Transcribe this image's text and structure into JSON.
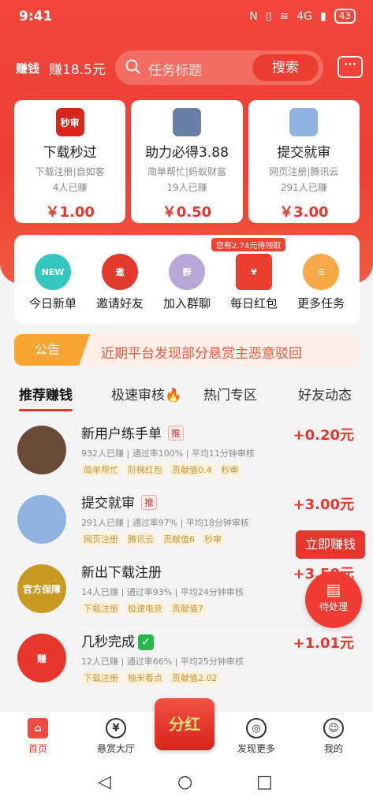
{
  "status": {
    "time": "9:41",
    "network": "4G",
    "battery": "43",
    "icons": [
      "nfc-icon",
      "vibrate-icon",
      "wifi-icon",
      "signal-icon"
    ]
  },
  "header": {
    "logo": "赚钱",
    "earned": "赚18.5元",
    "search_placeholder": "任务标题",
    "search_button": "搜索"
  },
  "featured": [
    {
      "icon": "秒审",
      "icon_color": "#d9261c",
      "title": "下载秒过",
      "desc": "下载注册|自如客",
      "count": "4人已赚",
      "price": "￥1.00"
    },
    {
      "icon": "",
      "icon_color": "#6a7fa8",
      "title": "助力必得3.88",
      "desc": "简单帮忙|蚂蚁财富",
      "count": "19人已赚",
      "price": "￥0.50"
    },
    {
      "icon": "",
      "icon_color": "#8fb3e0",
      "title": "提交就审",
      "desc": "网页注册|腾讯云",
      "count": "291人已赚",
      "price": "￥3.00"
    }
  ],
  "quick": {
    "pending_tag": "您有2.74元待领取",
    "items": [
      {
        "label": "今日新单",
        "icon": "NEW",
        "color": "#34c7c0"
      },
      {
        "label": "邀请好友",
        "icon": "邀",
        "color": "#e23a2c"
      },
      {
        "label": "加入群聊",
        "icon": "群",
        "color": "#b9a6d8"
      },
      {
        "label": "每日红包",
        "icon": "¥",
        "color": "#ec3d31"
      },
      {
        "label": "更多任务",
        "icon": "☰",
        "color": "#f7a94a"
      }
    ]
  },
  "notice": {
    "label": "公告",
    "text": "近期平台发现部分悬赏主恶意驳回"
  },
  "tabs": [
    "推荐赚钱",
    "极速审核🔥",
    "热门专区",
    "好友动态"
  ],
  "tasks": [
    {
      "title": "新用户练手单",
      "tag": "推",
      "check": false,
      "meta": "932人已赚 | 通过率100% | 平均11分钟审核",
      "tags": [
        "简单帮忙",
        "阶梯红包",
        "贡献值0.4",
        "秒审"
      ],
      "reward": "+0.20元",
      "avatar_color": "#6b4a3a"
    },
    {
      "title": "提交就审",
      "tag": "推",
      "check": false,
      "meta": "291人已赚 | 通过率97% | 平均18分钟审核",
      "tags": [
        "网页注册",
        "腾讯云",
        "贡献值6",
        "秒审"
      ],
      "reward": "+3.00元",
      "avatar_color": "#8fb3e0"
    },
    {
      "title": "新出下载注册",
      "tag": "",
      "check": false,
      "meta": "14人已赚 | 通过率93% | 平均24分钟审核",
      "tags": [
        "下载注册",
        "极速电竞",
        "贡献值7"
      ],
      "reward": "+3.50元",
      "avatar_color": "#c99a22",
      "avatar_text": "官方保障"
    },
    {
      "title": "几秒完成",
      "tag": "",
      "check": true,
      "meta": "12人已赚 | 通过率66% | 平均25分钟审核",
      "tags": [
        "下载注册",
        "柚米看点",
        "贡献值2.02"
      ],
      "reward": "+1.01元",
      "avatar_color": "#e8362c",
      "avatar_text": "赚"
    }
  ],
  "floating": {
    "earn_now": "立即赚钱",
    "pending": "待处理"
  },
  "bottom_nav": [
    {
      "label": "首页",
      "icon": "⌂"
    },
    {
      "label": "悬赏大厅",
      "icon": "¥"
    },
    {
      "label": "发现更多",
      "icon": "◎"
    },
    {
      "label": "我的",
      "icon": "☺"
    }
  ],
  "fenhong": "分红"
}
